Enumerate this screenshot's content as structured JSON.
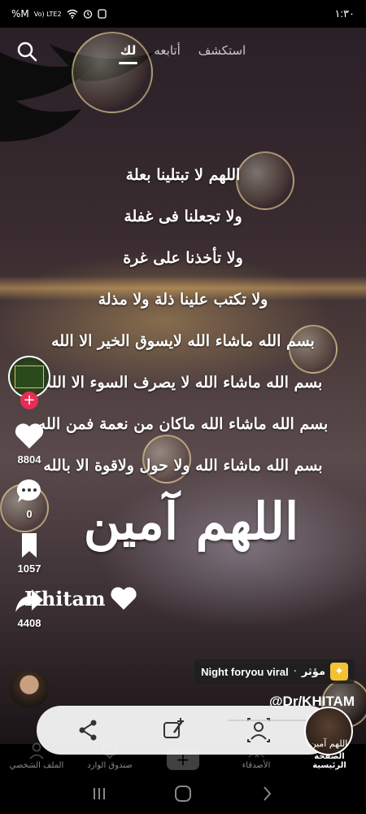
{
  "status_bar": {
    "time": "١:٣٠",
    "left_icons_text": "%M",
    "network": "Vo) LTE2"
  },
  "top_nav": {
    "tabs": [
      {
        "label": "استكشف",
        "active": false
      },
      {
        "label": "أتابعه",
        "active": false
      },
      {
        "label": "لك",
        "active": true
      }
    ],
    "search_icon": "search-icon"
  },
  "video": {
    "poem_lines": [
      "اللهم لا تبتلينا بعلة",
      "ولا تجعلنا فى غفلة",
      "ولا تأخذنا على غرة",
      "ولا تكتب علينا ذلة ولا مذلة",
      "بسم الله ماشاء الله لايسوق الخير الا الله",
      "بسم الله ماشاء الله لا يصرف السوء الا الله",
      "بسم الله ماشاء الله ماكان من نعمة فمن الله",
      "بسم الله ماشاء الله ولا حول ولاقوة الا بالله"
    ],
    "amen_text": "اللهم آمين",
    "signature": "Khitam"
  },
  "side_rail": {
    "likes": "8804",
    "comments": "0",
    "saves": "1057",
    "shares": "4408",
    "colors": {
      "follow": "#ea2c55",
      "promo": "#f3c234"
    }
  },
  "caption": {
    "promo_label": "مؤثر",
    "promo_text": "Night foryou viral",
    "username": "@Dr/KHITAM",
    "thumb_text": "اللهم آمين"
  },
  "bottom_nav": {
    "items": [
      {
        "label": "الملف الشخصي",
        "active": false
      },
      {
        "label": "صندوق الوارد",
        "active": false
      },
      {
        "label": "",
        "active": false
      },
      {
        "label": "الأصدقاء",
        "active": false
      },
      {
        "label": "الصفحة الرئيسية",
        "active": true
      }
    ]
  }
}
